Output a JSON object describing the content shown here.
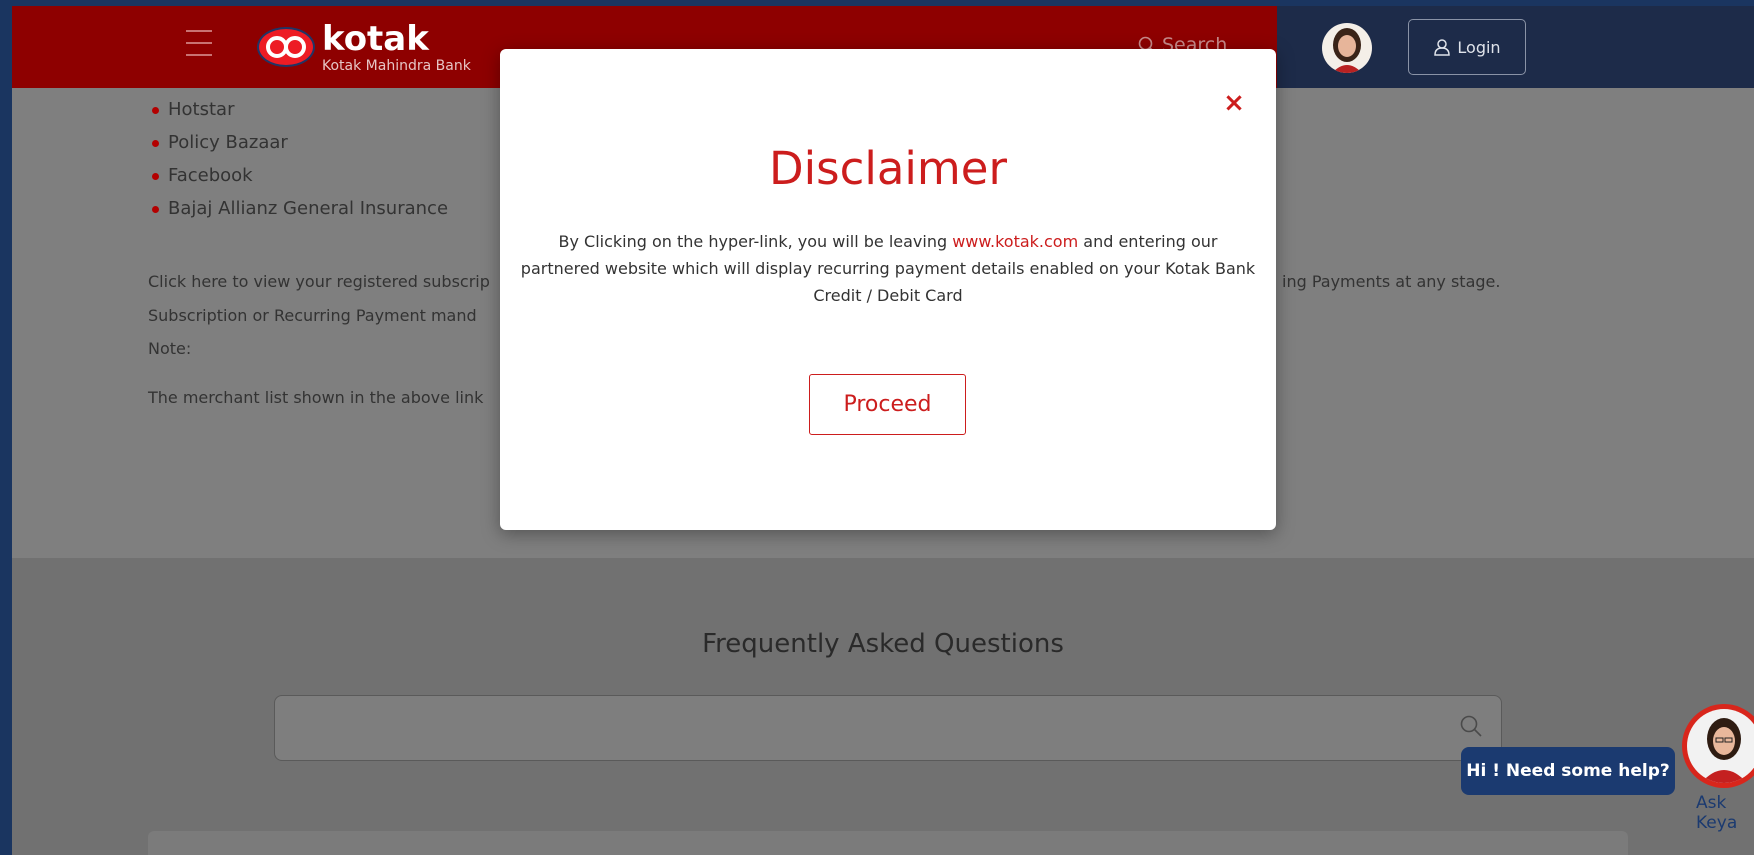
{
  "header": {
    "brand_name": "kotak",
    "brand_sub": "Kotak Mahindra Bank",
    "search_label": "Search",
    "login_label": "Login"
  },
  "content": {
    "bullets": [
      "Hotstar",
      "Policy Bazaar",
      "Facebook",
      "Bajaj Allianz General Insurance"
    ],
    "line1_left": "Click here to view your registered subscrip",
    "line1_right": "ing Payments at any stage.",
    "line2": "Subscription or Recurring Payment mand",
    "note_label": "Note:",
    "line3": "The merchant list shown in the above link"
  },
  "modal": {
    "close_symbol": "×",
    "title": "Disclaimer",
    "body_before": "By Clicking on the hyper-link, you will be leaving ",
    "body_link": "www.kotak.com",
    "body_after": " and entering our partnered website which will display recurring payment details enabled on your Kotak Bank Credit / Debit Card",
    "proceed_label": "Proceed"
  },
  "faq": {
    "title": "Frequently Asked Questions",
    "search_placeholder": ""
  },
  "chatbot": {
    "help_text": "Hi ! Need some help?",
    "ask_label": "Ask Keya"
  },
  "colors": {
    "brand_red": "#cc1d1d",
    "header_red": "#8e0000",
    "header_navy": "#1d2b49",
    "chat_navy": "#1b3a70"
  }
}
